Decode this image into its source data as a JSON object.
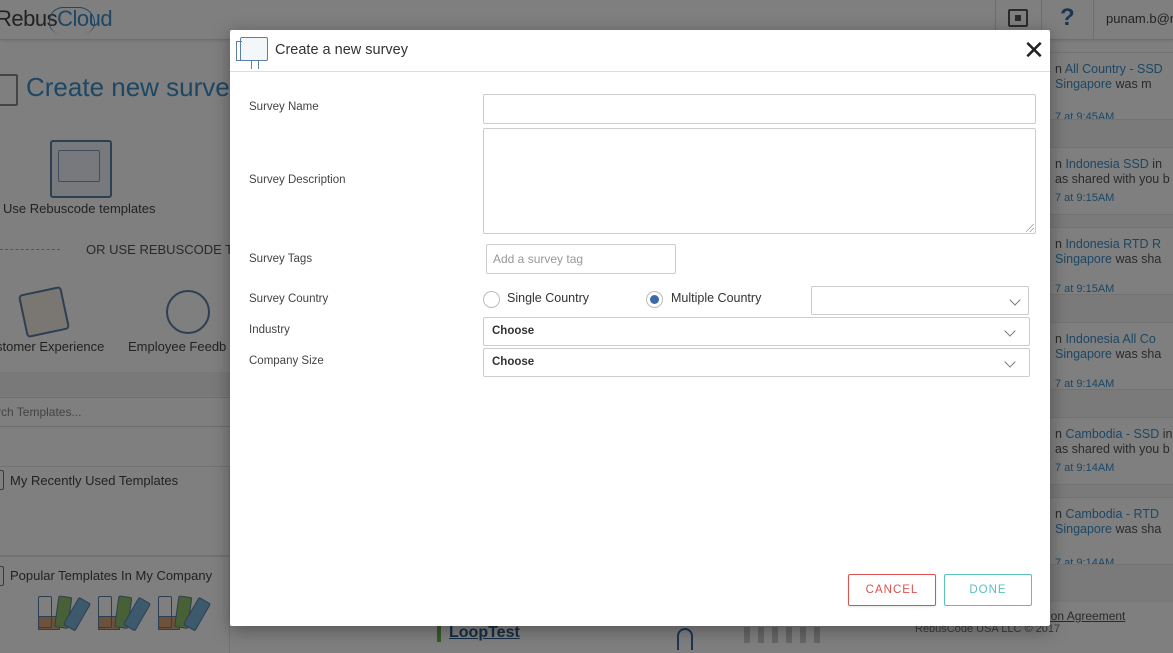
{
  "background": {
    "logo": {
      "part1": "Rebus",
      "part2": "Cloud"
    },
    "user_name": "punam.b@re",
    "help_label": "?",
    "page_title": "Create new surve",
    "use_templates_label": "Use Rebuscode templates",
    "or_use_label": "OR USE REBUSCODE TE",
    "categories": [
      {
        "label": "stomer Experience",
        "icon": "megaphone-icon"
      },
      {
        "label": "Employee Feedb",
        "icon": "people-icon"
      }
    ],
    "search_placeholder": "rch Templates...",
    "recent_label": "My Recently Used Templates",
    "popular_label": "Popular Templates In My Company",
    "activity": [
      {
        "line1_prefix": "n ",
        "line1_link": "All Country - SSD",
        "line2_link": "Singapore",
        "line2_suffix": " was m",
        "time": "7 at 9:45AM"
      },
      {
        "line1_prefix": "n ",
        "line1_link": "Indonesia SSD",
        "line1_suffix": " in",
        "line2_prefix": "as shared with you b",
        "time": "7 at 9:15AM"
      },
      {
        "line1_prefix": "n ",
        "line1_link": "Indonesia RTD R",
        "line2_link": "Singapore",
        "line2_suffix": " was sha",
        "time": "7 at 9:15AM"
      },
      {
        "line1_prefix": "n ",
        "line1_link": "Indonesia All Co",
        "line2_link": "Singapore",
        "line2_suffix": " was sha",
        "time": "7 at 9:14AM"
      },
      {
        "line1_prefix": "n ",
        "line1_link": "Cambodia - SSD",
        "line1_suffix": " in",
        "line2_prefix": "as shared with you b",
        "time": "7 at 9:14AM"
      },
      {
        "line1_prefix": "n ",
        "line1_link": "Cambodia - RTD",
        "line2_link": "Singapore",
        "line2_suffix": " was sha",
        "time": "7 at 9:14AM"
      }
    ],
    "footer_link": "ption Agreement",
    "footer_copy": "RebusCode USA LLC © 2017",
    "loop_test_label": "LoopTest"
  },
  "modal": {
    "title": "Create a new survey",
    "close_label": "✕",
    "fields": {
      "survey_name": {
        "label": "Survey Name",
        "value": ""
      },
      "survey_description": {
        "label": "Survey Description",
        "value": ""
      },
      "survey_tags": {
        "label": "Survey Tags",
        "placeholder": "Add a survey tag"
      },
      "survey_country": {
        "label": "Survey Country",
        "options": [
          "Single Country",
          "Multiple Country"
        ],
        "selected": "Multiple Country",
        "dropdown_value": ""
      },
      "industry": {
        "label": "Industry",
        "value": "Choose"
      },
      "company_size": {
        "label": "Company Size",
        "value": "Choose"
      }
    },
    "buttons": {
      "cancel": "CANCEL",
      "done": "DONE"
    },
    "colors": {
      "cancel": "#d9534f",
      "done": "#5bbfbf",
      "accent": "#3a6aa8"
    }
  }
}
